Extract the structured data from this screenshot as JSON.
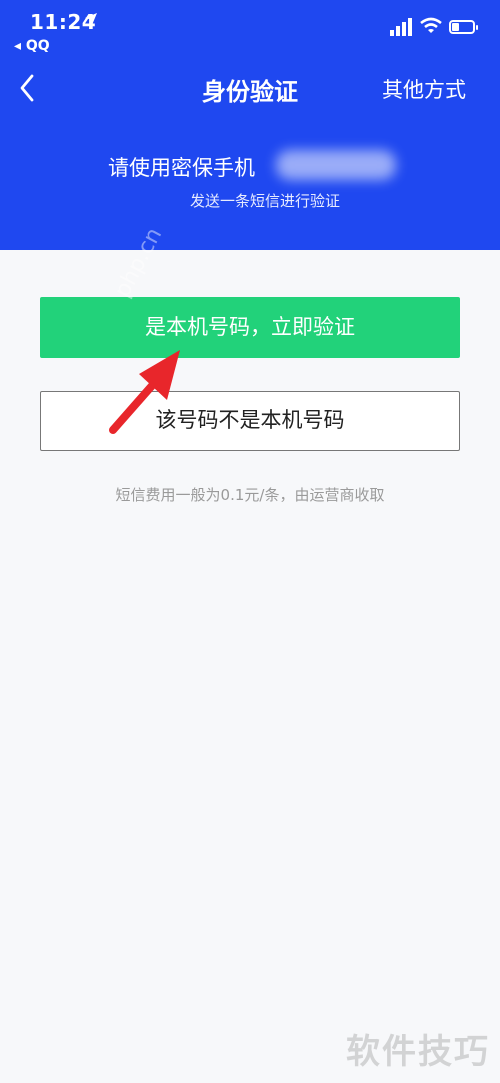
{
  "status_bar": {
    "time": "11:24",
    "back_app": "◂ QQ"
  },
  "nav": {
    "title": "身份验证",
    "other_label": "其他方式"
  },
  "prompt": {
    "main": "请使用密保手机",
    "sub": "发送一条短信进行验证"
  },
  "actions": {
    "confirm_label": "是本机号码，立即验证",
    "not_mine_label": "该号码不是本机号码"
  },
  "fee_note": "短信费用一般为0.1元/条，由运营商收取",
  "watermarks": {
    "diagonal": "php.cn",
    "corner": "软件技巧"
  },
  "colors": {
    "header_bg": "#1f48f0",
    "confirm_bg": "#22d27a",
    "annotation_arrow": "#e8262b"
  },
  "icons": {
    "location": "location-arrow-icon",
    "signal": "cellular-signal-icon",
    "wifi": "wifi-icon",
    "battery": "battery-icon",
    "back": "chevron-left-icon"
  }
}
